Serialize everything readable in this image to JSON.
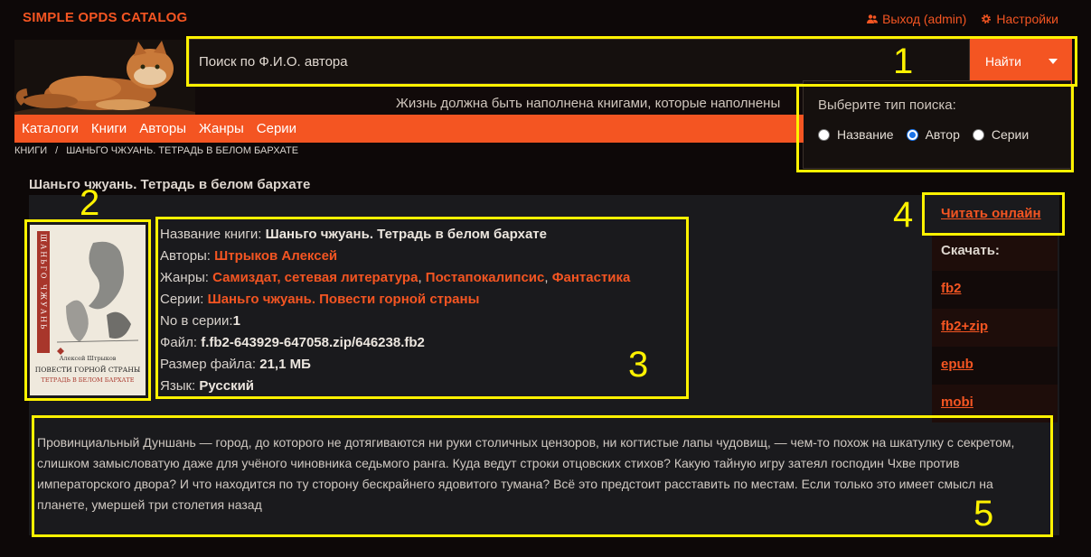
{
  "app": {
    "brand": "SIMPLE OPDS CATALOG",
    "logout": "Выход (admin)",
    "settings": "Настройки",
    "tagline": "Жизнь должна быть наполнена книгами, которые наполнены"
  },
  "search": {
    "value": "Поиск по Ф.И.О. автора",
    "button": "Найти",
    "type_title": "Выберите тип поиска:",
    "types": [
      "Название",
      "Автор",
      "Серии"
    ],
    "selected": "Автор"
  },
  "nav": [
    "Каталоги",
    "Книги",
    "Авторы",
    "Жанры",
    "Серии"
  ],
  "breadcrumb": [
    "КНИГИ",
    "/",
    "ШАНЬГО ЧЖУАНЬ. ТЕТРАДЬ В БЕЛОМ БАРХАТЕ"
  ],
  "book": {
    "title": "Шаньго чжуань. Тетрадь в белом бархате",
    "cover": {
      "vertical_title": "ШАНЬГО ЧЖУАНЬ",
      "author": "Алексей Штрыков",
      "line1": "ПОВЕСТИ ГОРНОЙ СТРАНЫ",
      "line2": "ТЕТРАДЬ В БЕЛОМ БАРХАТЕ"
    },
    "labels": {
      "name": "Название книги:",
      "authors": "Авторы:",
      "genres": "Жанры:",
      "series": "Серии:",
      "number": "No в серии:",
      "file": "Файл:",
      "size": "Размер файла:",
      "lang": "Язык:"
    },
    "name": "Шаньго чжуань. Тетрадь в белом бархате",
    "author": "Штрыков Алексей",
    "genres": [
      "Самиздат, сетевая литература",
      "Постапокалипсис",
      "Фантастика"
    ],
    "series": "Шаньго чжуань. Повести горной страны",
    "number": "1",
    "file": "f.fb2-643929-647058.zip/646238.fb2",
    "size": "21,1 МБ",
    "lang": "Русский",
    "annotation": "Провинциальный Дуншань — город, до которого не дотягиваются ни руки столичных цензоров, ни когтистые лапы чудовищ, — чем-то похож на шкатулку с секретом, слишком замысловатую даже для учёного чиновника седьмого ранга. Куда ведут строки отцовских стихов? Какую тайную игру затеял господин Чхве против императорского двора? И что находится по ту сторону бескрайнего ядовитого тумана? Всё это предстоит расставить по местам. Если только это имеет смысл на планете, умершей три столетия назад"
  },
  "actions": {
    "read_online": "Читать онлайн",
    "download": "Скачать:",
    "formats": [
      "fb2",
      "fb2+zip",
      "epub",
      "mobi"
    ]
  },
  "callouts": [
    "1",
    "2",
    "3",
    "4",
    "5"
  ],
  "colors": {
    "accent": "#f45522",
    "highlight": "#fff200",
    "background": "#0d0808"
  }
}
